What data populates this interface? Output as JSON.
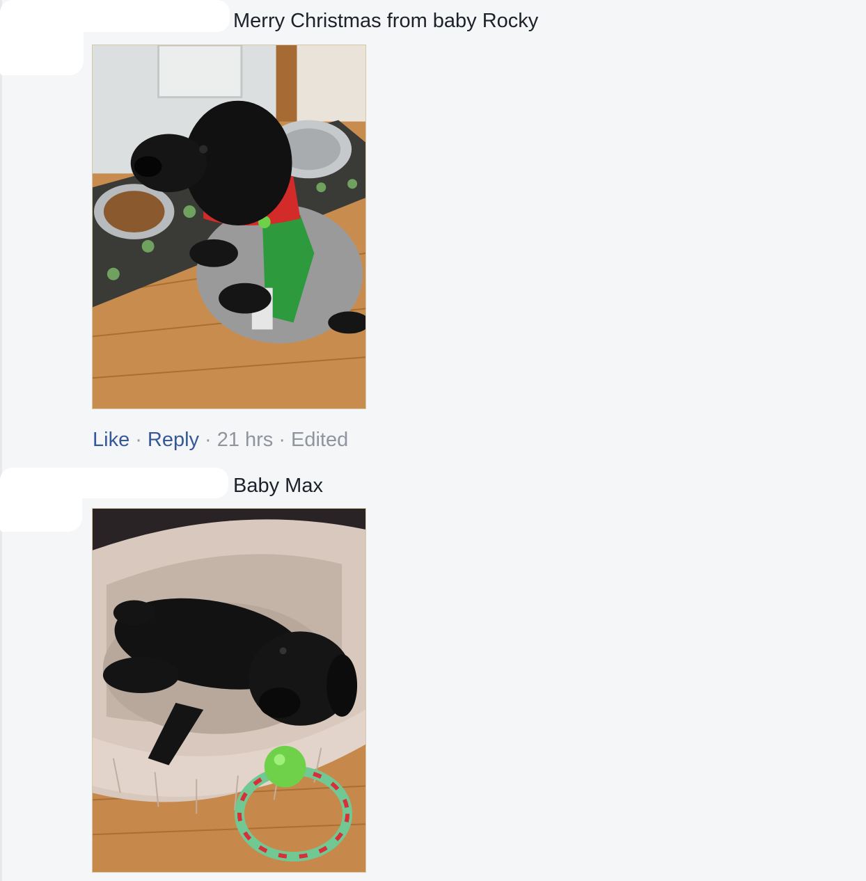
{
  "comments": [
    {
      "text": "Merry Christmas from baby Rocky",
      "photo": {
        "subject": "black-lab-puppy-in-elf-sweater",
        "colors": {
          "floor": "#c98c4f",
          "sweater": "#9a9a9a",
          "collar": "#d32a2a"
        }
      }
    },
    {
      "text": "Baby Max",
      "photo": {
        "subject": "black-lab-puppy-in-dog-bed",
        "colors": {
          "bed": "#d8c8bd",
          "floor": "#c7884b",
          "ball": "#6fd14a"
        }
      }
    }
  ],
  "actions": {
    "like": "Like",
    "reply": "Reply",
    "time": "21 hrs",
    "edited": "Edited",
    "separator": "·"
  },
  "colors": {
    "link": "#365899",
    "meta": "#90949c",
    "text": "#1d2129",
    "background": "#f5f6f8"
  }
}
